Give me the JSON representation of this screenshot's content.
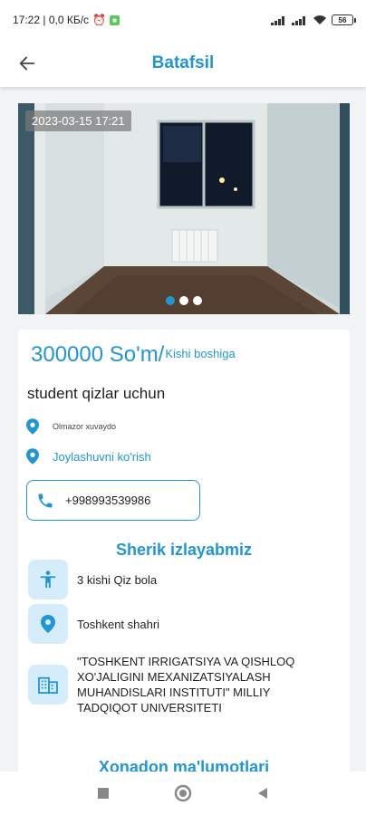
{
  "status_bar": {
    "left_text": "17:22 | 0,0 КБ/с",
    "battery": "56"
  },
  "app_bar": {
    "title": "Batafsil"
  },
  "photo": {
    "date": "2023-03-15 17:21",
    "dots_count": 3,
    "active_dot": 0
  },
  "listing": {
    "price": "300000 So'm/",
    "price_unit": "Kishi boshiga",
    "title": "student qizlar uchun",
    "address": "Olmazor xuvaydo",
    "map_link": "Joylashuvni ko'rish",
    "phone": "+998993539986"
  },
  "partner_section": {
    "heading": "Sherik izlayabmiz",
    "items": [
      {
        "icon": "person-icon",
        "text": "3 kishi Qiz bola"
      },
      {
        "icon": "location-pin-icon",
        "text": "Toshkent shahri"
      },
      {
        "icon": "building-icon",
        "text": "\"TOSHKENT IRRIGATSIYA VA QISHLOQ XO'JALIGINI MEXANIZATSIYALASH MUHANDISLARI INSTITUTI\" MILLIY TADQIQOT UNIVERSITETI"
      }
    ]
  },
  "apartment_section": {
    "heading": "Xonadon ma'lumotlari"
  },
  "colors": {
    "accent": "#2196d3",
    "icon_bg": "#d5ecfb",
    "page_bg": "#f2f3f5"
  }
}
